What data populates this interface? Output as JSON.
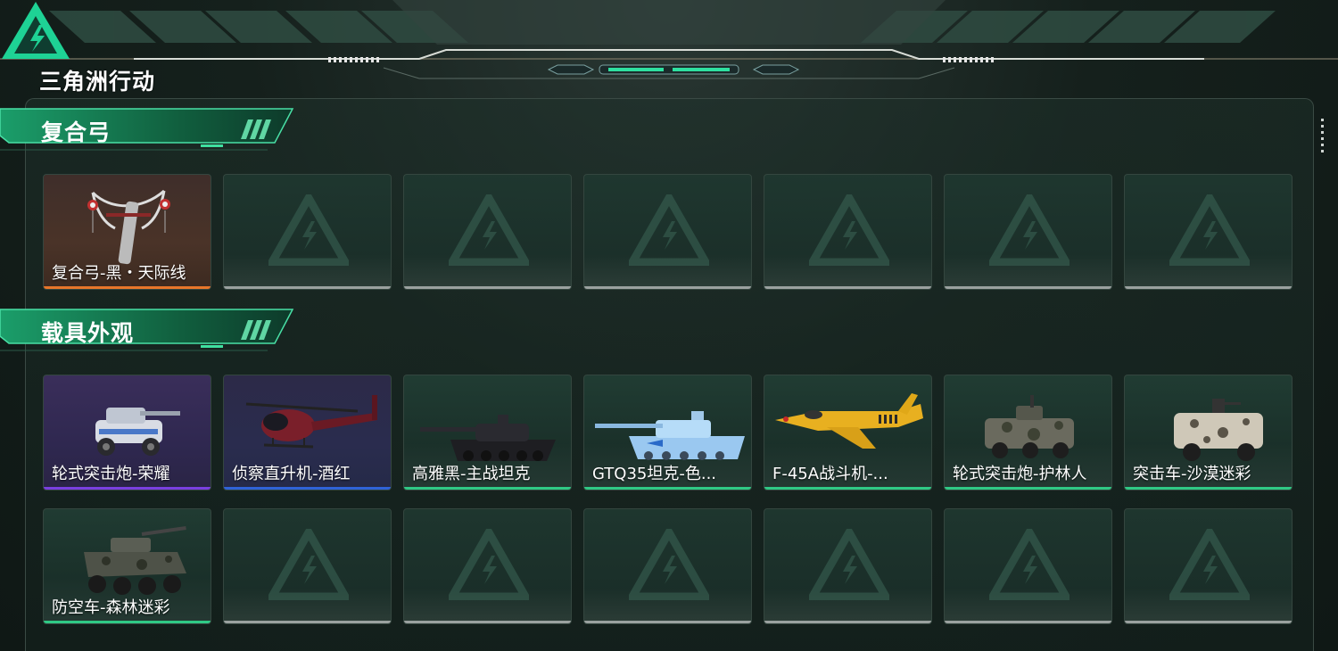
{
  "app": {
    "logo_text": "三角洲行动"
  },
  "colors": {
    "accent_green": "#27d08e",
    "rarity_orange": "#e8762a",
    "rarity_purple": "#7a3fe0",
    "rarity_blue": "#2f63d8",
    "rarity_green": "#2fc985",
    "empty_gray": "#9aa19f"
  },
  "sections": [
    {
      "title": "复合弓",
      "items": [
        {
          "label": "复合弓-黑・天际线",
          "rarity": "orange",
          "icon": "compound-bow-icon"
        },
        {
          "label": "",
          "rarity": "empty"
        },
        {
          "label": "",
          "rarity": "empty"
        },
        {
          "label": "",
          "rarity": "empty"
        },
        {
          "label": "",
          "rarity": "empty"
        },
        {
          "label": "",
          "rarity": "empty"
        },
        {
          "label": "",
          "rarity": "empty"
        }
      ]
    },
    {
      "title": "载具外观",
      "items": [
        {
          "label": "轮式突击炮-荣耀",
          "rarity": "purple",
          "icon": "wheeled-assault-gun-icon"
        },
        {
          "label": "侦察直升机-酒红",
          "rarity": "blue",
          "icon": "scout-helicopter-icon"
        },
        {
          "label": "高雅黑-主战坦克",
          "rarity": "green",
          "icon": "main-battle-tank-icon"
        },
        {
          "label": "GTQ35坦克-色...",
          "rarity": "green",
          "icon": "light-tank-icon"
        },
        {
          "label": "F-45A战斗机-...",
          "rarity": "green",
          "icon": "fighter-jet-icon"
        },
        {
          "label": "轮式突击炮-护林人",
          "rarity": "green",
          "icon": "wheeled-assault-gun-camo-icon"
        },
        {
          "label": "突击车-沙漠迷彩",
          "rarity": "green",
          "icon": "assault-vehicle-icon"
        },
        {
          "label": "防空车-森林迷彩",
          "rarity": "green",
          "icon": "anti-air-vehicle-icon"
        },
        {
          "label": "",
          "rarity": "empty"
        },
        {
          "label": "",
          "rarity": "empty"
        },
        {
          "label": "",
          "rarity": "empty"
        },
        {
          "label": "",
          "rarity": "empty"
        },
        {
          "label": "",
          "rarity": "empty"
        },
        {
          "label": "",
          "rarity": "empty"
        }
      ]
    }
  ]
}
